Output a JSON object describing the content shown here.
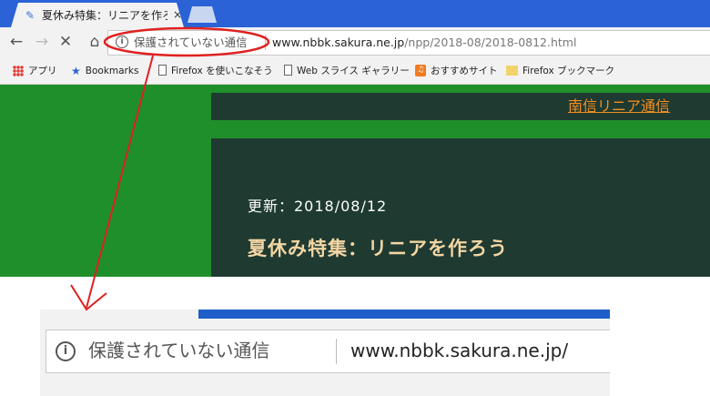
{
  "browser": {
    "tab": {
      "title": "夏休み特集：リニアを作ろう",
      "close": "×"
    },
    "nav": {
      "back": "←",
      "forward": "→",
      "stop": "✕",
      "home": "⌂"
    },
    "address": {
      "security_label": "保護されていない通信",
      "url_host": "www.nbbk.sakura.ne.jp",
      "url_path": "/npp/2018-08/2018-0812.html"
    },
    "bookmarks": [
      {
        "label": "アプリ",
        "icon": "apps-grid-icon"
      },
      {
        "label": "Bookmarks",
        "icon": "star-icon"
      },
      {
        "label": "Firefox を使いこなそう",
        "icon": "page-icon"
      },
      {
        "label": "Web スライス ギャラリー",
        "icon": "page-icon"
      },
      {
        "label": "おすすめサイト",
        "icon": "orange-bookmark-icon"
      },
      {
        "label": "Firefox ブックマーク",
        "icon": "folder-icon"
      }
    ]
  },
  "page": {
    "site_link": "南信リニア通信",
    "updated": "更新：2018/08/12",
    "headline": "夏休み特集：リニアを作ろう"
  },
  "zoom": {
    "security_label": "保護されていない通信",
    "url_host": "www.nbbk.sakura.ne.jp/"
  },
  "colors": {
    "tab_strip": "#2b63d6",
    "page_green": "#1f8f2a",
    "panel_dark": "#1f3a31",
    "link_orange": "#f28f22",
    "headline": "#f3d6a4",
    "annotation_red": "#e02020"
  }
}
